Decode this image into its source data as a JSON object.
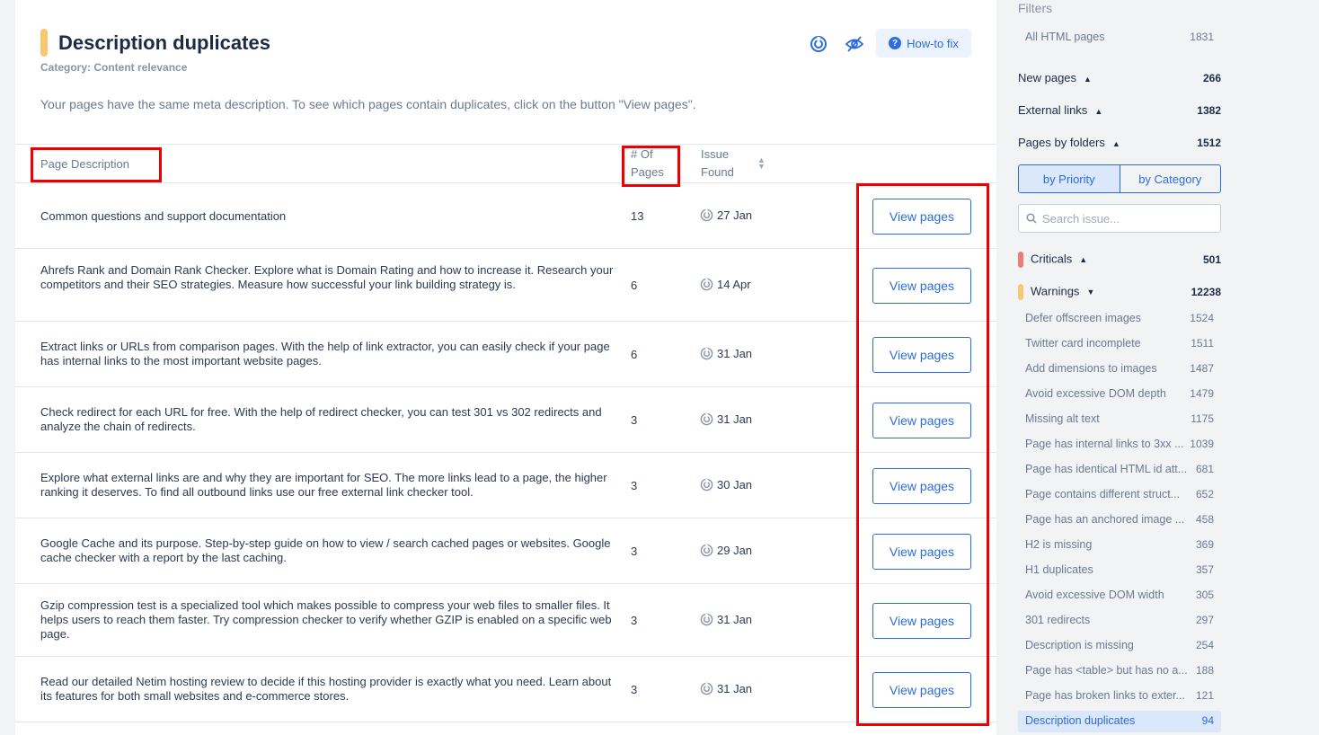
{
  "header": {
    "title": "Description duplicates",
    "category": "Category: Content relevance",
    "description": "Your pages have the same meta description. To see which pages contain duplicates, click on the button \"View pages\".",
    "howto_label": "How-to fix",
    "icons": [
      "ahrefs-rank-icon",
      "hide-icon",
      "question-icon"
    ]
  },
  "table": {
    "columns": {
      "description": "Page Description",
      "pages_line1": "# Of",
      "pages_line2": "Pages",
      "issue_line1": "Issue",
      "issue_line2": "Found"
    },
    "button_label": "View pages",
    "rows": [
      {
        "description": "Common questions and support documentation",
        "pages": "13",
        "date": "27 Jan"
      },
      {
        "description": "Ahrefs Rank and Domain Rank Checker. Explore what is Domain Rating and how to increase it. Research your competitors and their SEO strategies. Measure how successful your link building strategy is.",
        "pages": "6",
        "date": "14 Apr"
      },
      {
        "description": "Extract links or URLs from comparison pages. With the help of link extractor, you can easily check if your page has internal links to the most important website pages.",
        "pages": "6",
        "date": "31 Jan"
      },
      {
        "description": "Check redirect for each URL for free. With the help of redirect checker, you can test 301 vs 302 redirects and analyze the chain of redirects.",
        "pages": "3",
        "date": "31 Jan"
      },
      {
        "description": "Explore what external links are and why they are important for SEO. The more links lead to a page, the higher ranking it deserves. To find all outbound links use our free external link checker tool.",
        "pages": "3",
        "date": "30 Jan"
      },
      {
        "description": "Google Cache and its purpose. Step-by-step guide on how to view / search cached pages or websites. Google cache checker with a report by the last caching.",
        "pages": "3",
        "date": "29 Jan"
      },
      {
        "description": "Gzip compression test is a specialized tool which makes possible to compress your web files to smaller files. It helps users to reach them faster. Try compression checker to verify whether GZIP is enabled on a specific web page.",
        "pages": "3",
        "date": "31 Jan"
      },
      {
        "description": "Read our detailed Netim hosting review to decide if this hosting provider is exactly what you need. Learn about its features for both small websites and e-commerce stores.",
        "pages": "3",
        "date": "31 Jan"
      }
    ]
  },
  "sidebar": {
    "title": "Filters",
    "all_pages": {
      "label": "All HTML pages",
      "count": "1831"
    },
    "groups": [
      {
        "label": "New pages",
        "count": "266"
      },
      {
        "label": "External links",
        "count": "1382"
      },
      {
        "label": "Pages by folders",
        "count": "1512"
      }
    ],
    "segments": [
      "by Priority",
      "by Category"
    ],
    "search_placeholder": "Search issue...",
    "criticals": {
      "label": "Criticals",
      "count": "501",
      "color": "#f07a7a"
    },
    "warnings": {
      "label": "Warnings",
      "count": "12238",
      "color": "#f8c770"
    },
    "warning_items": [
      {
        "label": "Defer offscreen images",
        "count": "1524"
      },
      {
        "label": "Twitter card incomplete",
        "count": "1511"
      },
      {
        "label": "Add dimensions to images",
        "count": "1487"
      },
      {
        "label": "Avoid excessive DOM depth",
        "count": "1479"
      },
      {
        "label": "Missing alt text",
        "count": "1175"
      },
      {
        "label": "Page has internal links to 3xx ...",
        "count": "1039"
      },
      {
        "label": "Page has identical HTML id att...",
        "count": "681"
      },
      {
        "label": "Page contains different struct...",
        "count": "652"
      },
      {
        "label": "Page has an anchored image ...",
        "count": "458"
      },
      {
        "label": "H2 is missing",
        "count": "369"
      },
      {
        "label": "H1 duplicates",
        "count": "357"
      },
      {
        "label": "Avoid excessive DOM width",
        "count": "305"
      },
      {
        "label": "301 redirects",
        "count": "297"
      },
      {
        "label": "Description is missing",
        "count": "254"
      },
      {
        "label": "Page has <table> but has no a...",
        "count": "188"
      },
      {
        "label": "Page has broken links to exter...",
        "count": "121"
      },
      {
        "label": "Description duplicates",
        "count": "94"
      }
    ]
  },
  "colors": {
    "accent": "#2b6cde",
    "highlight": "#ee0000"
  }
}
